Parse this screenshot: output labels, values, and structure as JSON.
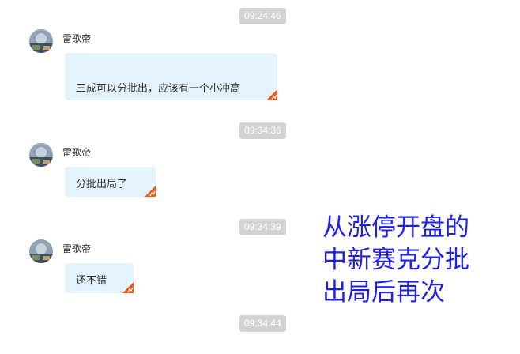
{
  "chat": {
    "messages": [
      {
        "time": "09:24:46",
        "sender": "雷歌帝",
        "text": "三成可以分批出，应该有一个小冲高"
      },
      {
        "time": "09:34:36",
        "sender": "雷歌帝",
        "text": "分批出局了"
      },
      {
        "time": "09:34:39",
        "sender": "雷歌帝",
        "text": "还不错"
      }
    ],
    "trailing_time": "09:34:44"
  },
  "overlay_note": {
    "lines": [
      "从涨停开盘的",
      "中新赛克分批",
      "出局后再次"
    ],
    "color": "#1f1fe6"
  },
  "colors": {
    "bubble_bg": "#e3f3fd",
    "time_pill_bg": "#d3d3d3",
    "corner_accent": "#ee5a1a"
  },
  "icons": {
    "avatar": "user-avatar-photo",
    "bubble_corner": "bubble-corner-tag-icon"
  }
}
